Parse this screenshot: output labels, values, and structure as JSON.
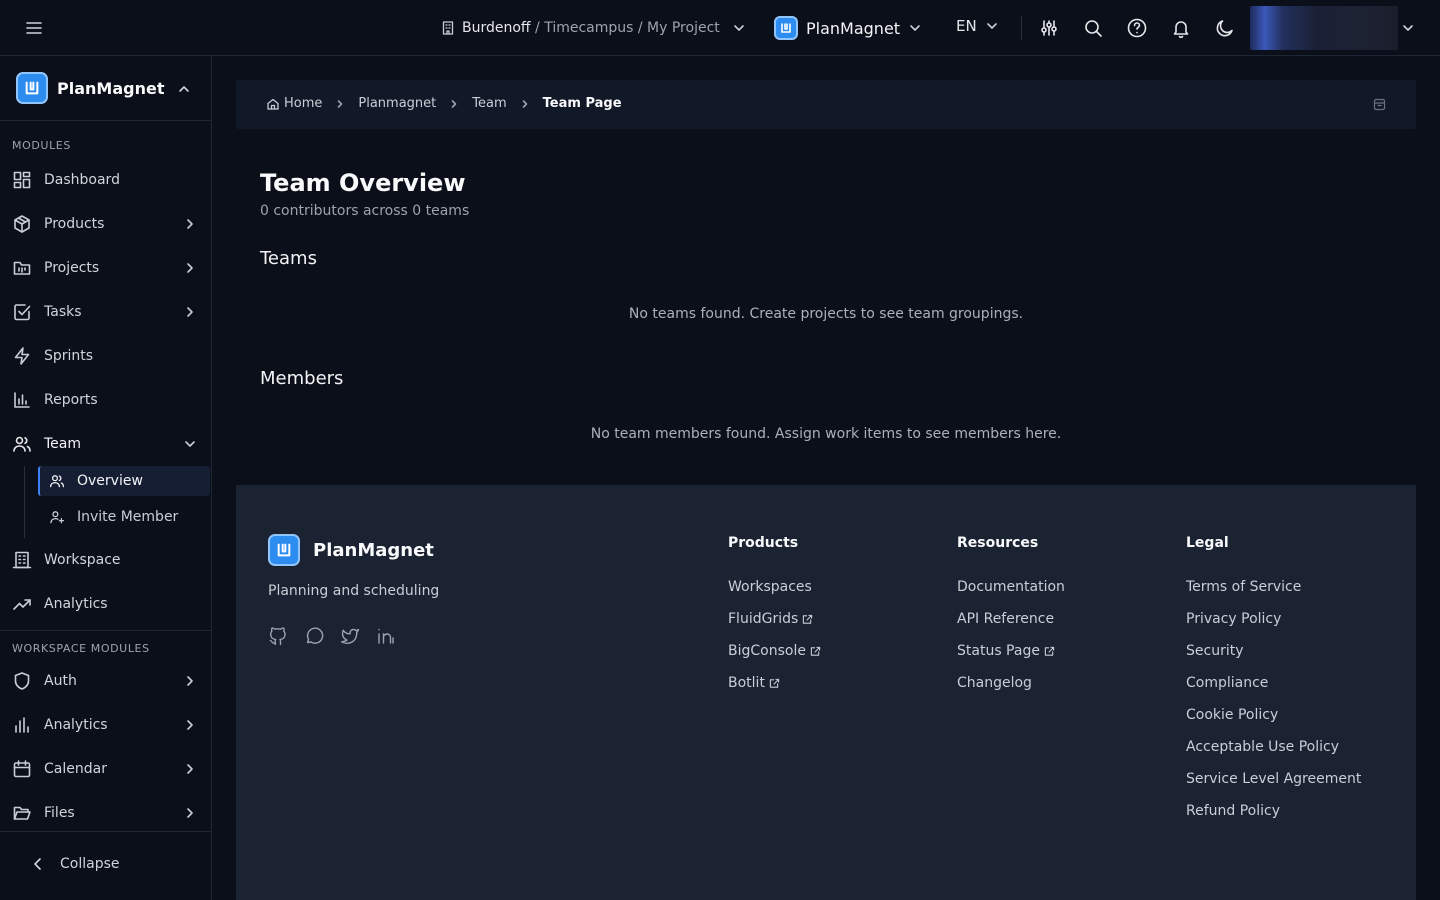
{
  "topbar": {
    "org": "Burdenoff",
    "path_rest": " / Timecampus / My Project",
    "app_name": "PlanMagnet",
    "language": "EN"
  },
  "sidebar": {
    "brand": "PlanMagnet",
    "section_modules": "MODULES",
    "items": [
      {
        "label": "Dashboard"
      },
      {
        "label": "Products"
      },
      {
        "label": "Projects"
      },
      {
        "label": "Tasks"
      },
      {
        "label": "Sprints"
      },
      {
        "label": "Reports"
      },
      {
        "label": "Team"
      },
      {
        "label": "Workspace"
      },
      {
        "label": "Analytics"
      }
    ],
    "team_sub": [
      {
        "label": "Overview"
      },
      {
        "label": "Invite Member"
      }
    ],
    "section_workspace": "WORKSPACE MODULES",
    "workspace_items": [
      {
        "label": "Auth"
      },
      {
        "label": "Analytics"
      },
      {
        "label": "Calendar"
      },
      {
        "label": "Files"
      }
    ],
    "collapse_label": "Collapse"
  },
  "breadcrumb": {
    "items": [
      "Home",
      "Planmagnet",
      "Team",
      "Team Page"
    ]
  },
  "main": {
    "title": "Team Overview",
    "subtitle": "0 contributors across 0 teams",
    "teams_heading": "Teams",
    "teams_empty": "No teams found. Create projects to see team groupings.",
    "members_heading": "Members",
    "members_empty": "No team members found. Assign work items to see members here."
  },
  "footer": {
    "brand": "PlanMagnet",
    "tagline": "Planning and scheduling",
    "columns": [
      {
        "title": "Products",
        "links": [
          "Workspaces",
          "FluidGrids",
          "BigConsole",
          "Botlit"
        ]
      },
      {
        "title": "Resources",
        "links": [
          "Documentation",
          "API Reference",
          "Status Page",
          "Changelog"
        ]
      },
      {
        "title": "Legal",
        "links": [
          "Terms of Service",
          "Privacy Policy",
          "Security",
          "Compliance",
          "Cookie Policy",
          "Acceptable Use Policy",
          "Service Level Agreement",
          "Refund Policy"
        ]
      }
    ]
  },
  "colors": {
    "background": "#0b0f19",
    "panel": "#111827",
    "footer": "#1b2332",
    "accent": "#3b82f6",
    "logo": "#2d8cf0"
  }
}
